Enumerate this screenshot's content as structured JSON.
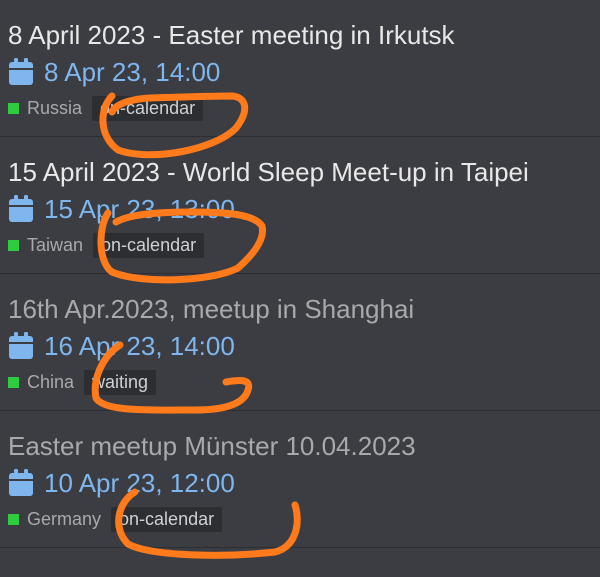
{
  "events": [
    {
      "title": "8 April 2023 - Easter meeting in Irkutsk",
      "date": "8 Apr 23, 14:00",
      "country": "Russia",
      "status": "on-calendar",
      "title_style": "bright"
    },
    {
      "title": "15 April 2023 - World Sleep Meet-up in Taipei",
      "date": "15 Apr 23, 13:00",
      "country": "Taiwan",
      "status": "on-calendar",
      "title_style": "bright"
    },
    {
      "title": "16th Apr.2023, meetup in Shanghai",
      "date": "16 Apr 23, 14:00",
      "country": "China",
      "status": "waiting",
      "title_style": "dim"
    },
    {
      "title": "Easter meetup Münster 10.04.2023",
      "date": "10 Apr 23, 12:00",
      "country": "Germany",
      "status": "on-calendar",
      "title_style": "dim"
    }
  ],
  "colors": {
    "background": "#3b3d42",
    "date_blue": "#7fb6ee",
    "country_square": "#2ecc40",
    "annotation_orange": "#ff7a1a"
  }
}
